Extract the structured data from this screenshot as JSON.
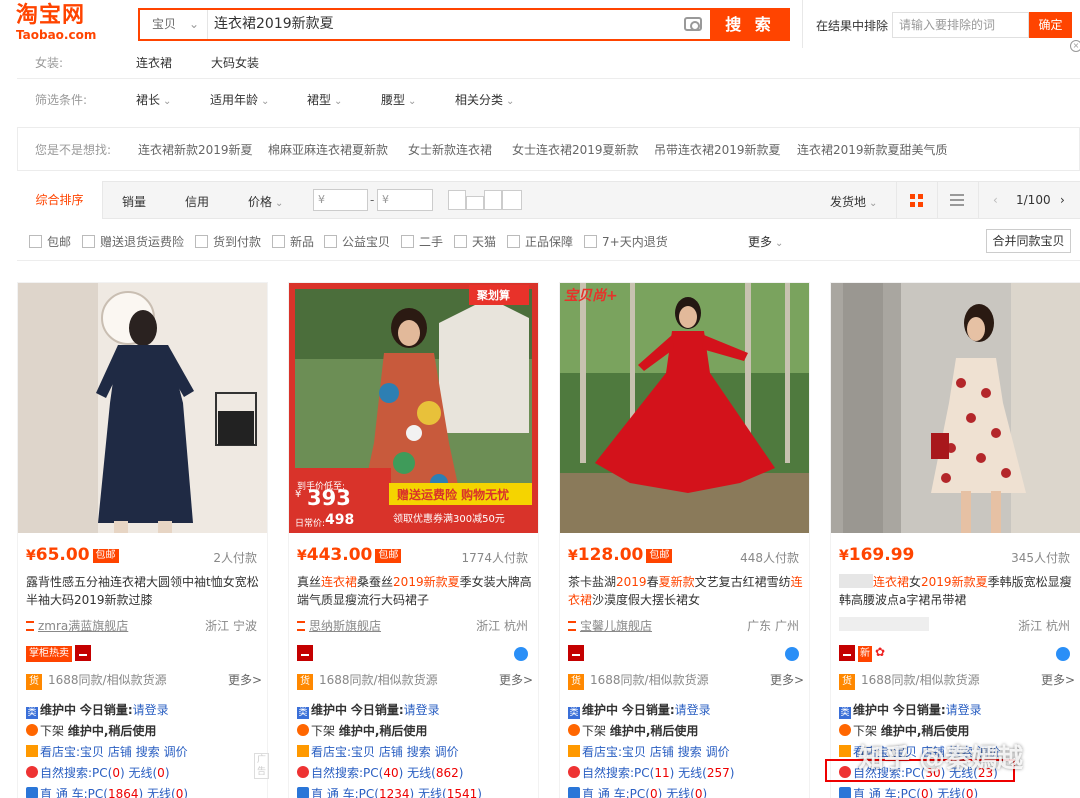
{
  "header": {
    "logo_cn": "淘宝网",
    "logo_en": "Taobao.com",
    "search_category": "宝贝",
    "search_query": "连衣裙2019新款夏",
    "search_button": "搜 索",
    "exclude_label": "在结果中排除",
    "exclude_placeholder": "请输入要排除的词",
    "exclude_button": "确定"
  },
  "filters": {
    "row1_label": "女装:",
    "row1_items": [
      "连衣裙",
      "大码女装"
    ],
    "row2_label": "筛选条件:",
    "row2_items": [
      "裙长",
      "适用年龄",
      "裙型",
      "腰型",
      "相关分类"
    ]
  },
  "suggest": {
    "label": "您是不是想找:",
    "items": [
      "连衣裙新款2019新夏",
      "棉麻亚麻连衣裙夏新款",
      "女士新款连衣裙",
      "女士连衣裙2019夏新款",
      "吊带连衣裙2019新款夏",
      "连衣裙2019新款夏甜美气质"
    ]
  },
  "sortbar": {
    "items": [
      "综合排序",
      "销量",
      "信用",
      "价格"
    ],
    "price_min": "¥",
    "price_max": "¥",
    "range_sep": "-",
    "ship_from": "发货地",
    "pager": "1/100"
  },
  "checkboxes": [
    "包邮",
    "赠送退货运费险",
    "货到付款",
    "新品",
    "公益宝贝",
    "二手",
    "天猫",
    "正品保障",
    "7+天内退货"
  ],
  "more_label": "更多",
  "merge_label": "合并同款宝贝",
  "promo": {
    "tag": "聚划算",
    "price_label": "到手价低至:",
    "price": "393",
    "daily_label": "日常价:",
    "daily": "498",
    "banner1": "赠送运费险 购物无忧",
    "banner2": "领取优惠券满300减50元",
    "tag3": "宝贝尚+"
  },
  "products": [
    {
      "price": "65.00",
      "baoyou": "包邮",
      "sales": "2人付款",
      "title_parts": [
        "露背性感五分袖连衣裙大圆领中袖t恤女宽松半袖大码2019新款过膝"
      ],
      "shop": "zmra满蓝旗舰店",
      "location": "浙江 宁波",
      "badge": "掌柜热卖",
      "src_text": "1688同款/相似款货源",
      "more": "更多>",
      "plug1": [
        "维护中",
        "今日销量:",
        "请登录"
      ],
      "plug2": [
        "下架",
        "维护中,稍后使用"
      ],
      "plug3": [
        "看店宝:宝贝",
        "店铺",
        "搜索",
        "调价"
      ],
      "natural": [
        "自然搜索:PC(",
        "0",
        ") 无线(",
        "0",
        ")"
      ],
      "direct": [
        "直 通 车:PC(",
        "1864",
        ") 无线(",
        "0",
        ")"
      ],
      "ad": "广告"
    },
    {
      "price": "443.00",
      "baoyou": "包邮",
      "sales": "1774人付款",
      "title_parts": [
        "真丝",
        "连衣裙",
        "桑蚕丝",
        "2019新款夏",
        "季女装大牌高端气质显瘦流行大码裙子"
      ],
      "shop": "思纳斯旗舰店",
      "location": "浙江 杭州",
      "src_text": "1688同款/相似款货源",
      "more": "更多>",
      "plug1": [
        "维护中",
        "今日销量:",
        "请登录"
      ],
      "plug2": [
        "下架",
        "维护中,稍后使用"
      ],
      "plug3": [
        "看店宝:宝贝",
        "店铺",
        "搜索",
        "调价"
      ],
      "natural": [
        "自然搜索:PC(",
        "40",
        ") 无线(",
        "862",
        ")"
      ],
      "direct": [
        "直 通 车:PC(",
        "1234",
        ") 无线(",
        "1541",
        ")"
      ]
    },
    {
      "price": "128.00",
      "baoyou": "包邮",
      "sales": "448人付款",
      "title_parts": [
        "茶卡盐湖",
        "2019",
        "春",
        "夏新款",
        "文艺复古红裙雪纺",
        "连衣裙",
        "沙漠度假大摆长裙女"
      ],
      "shop": "宝馨儿旗舰店",
      "location": "广东 广州",
      "src_text": "1688同款/相似款货源",
      "more": "更多>",
      "plug1": [
        "维护中",
        "今日销量:",
        "请登录"
      ],
      "plug2": [
        "下架",
        "维护中,稍后使用"
      ],
      "plug3": [
        "看店宝:宝贝",
        "店铺",
        "搜索",
        "调价"
      ],
      "natural": [
        "自然搜索:PC(",
        "11",
        ") 无线(",
        "257",
        ")"
      ],
      "direct": [
        "直 通 车:PC(",
        "0",
        ") 无线(",
        "0",
        ")"
      ]
    },
    {
      "price": "169.99",
      "sales": "345人付款",
      "title_parts": [
        "连衣裙",
        "女",
        "2019新款夏",
        "季韩版宽松显瘦韩高腰波点a字裙吊带裙"
      ],
      "shop": "",
      "location": "浙江 杭州",
      "badge_xin": "新",
      "src_text": "1688同款/相似款货源",
      "more": "更多>",
      "plug1": [
        "维护中",
        "今日销量:",
        "请登录"
      ],
      "plug2": [
        "下架",
        "维护中,稍后使用"
      ],
      "plug3": [
        "看店宝:宝贝",
        "店铺",
        "搜索",
        "调价"
      ],
      "natural": [
        "自然搜索:PC(",
        "30",
        ") 无线(",
        "23",
        ")"
      ],
      "direct": [
        "直 通 车:PC(",
        "0",
        ") 无线(",
        "0",
        ")"
      ]
    }
  ],
  "watermark": "知乎 @秦嫣越",
  "colors": {
    "accent": "#ff4400",
    "link": "#2a5fc2"
  }
}
